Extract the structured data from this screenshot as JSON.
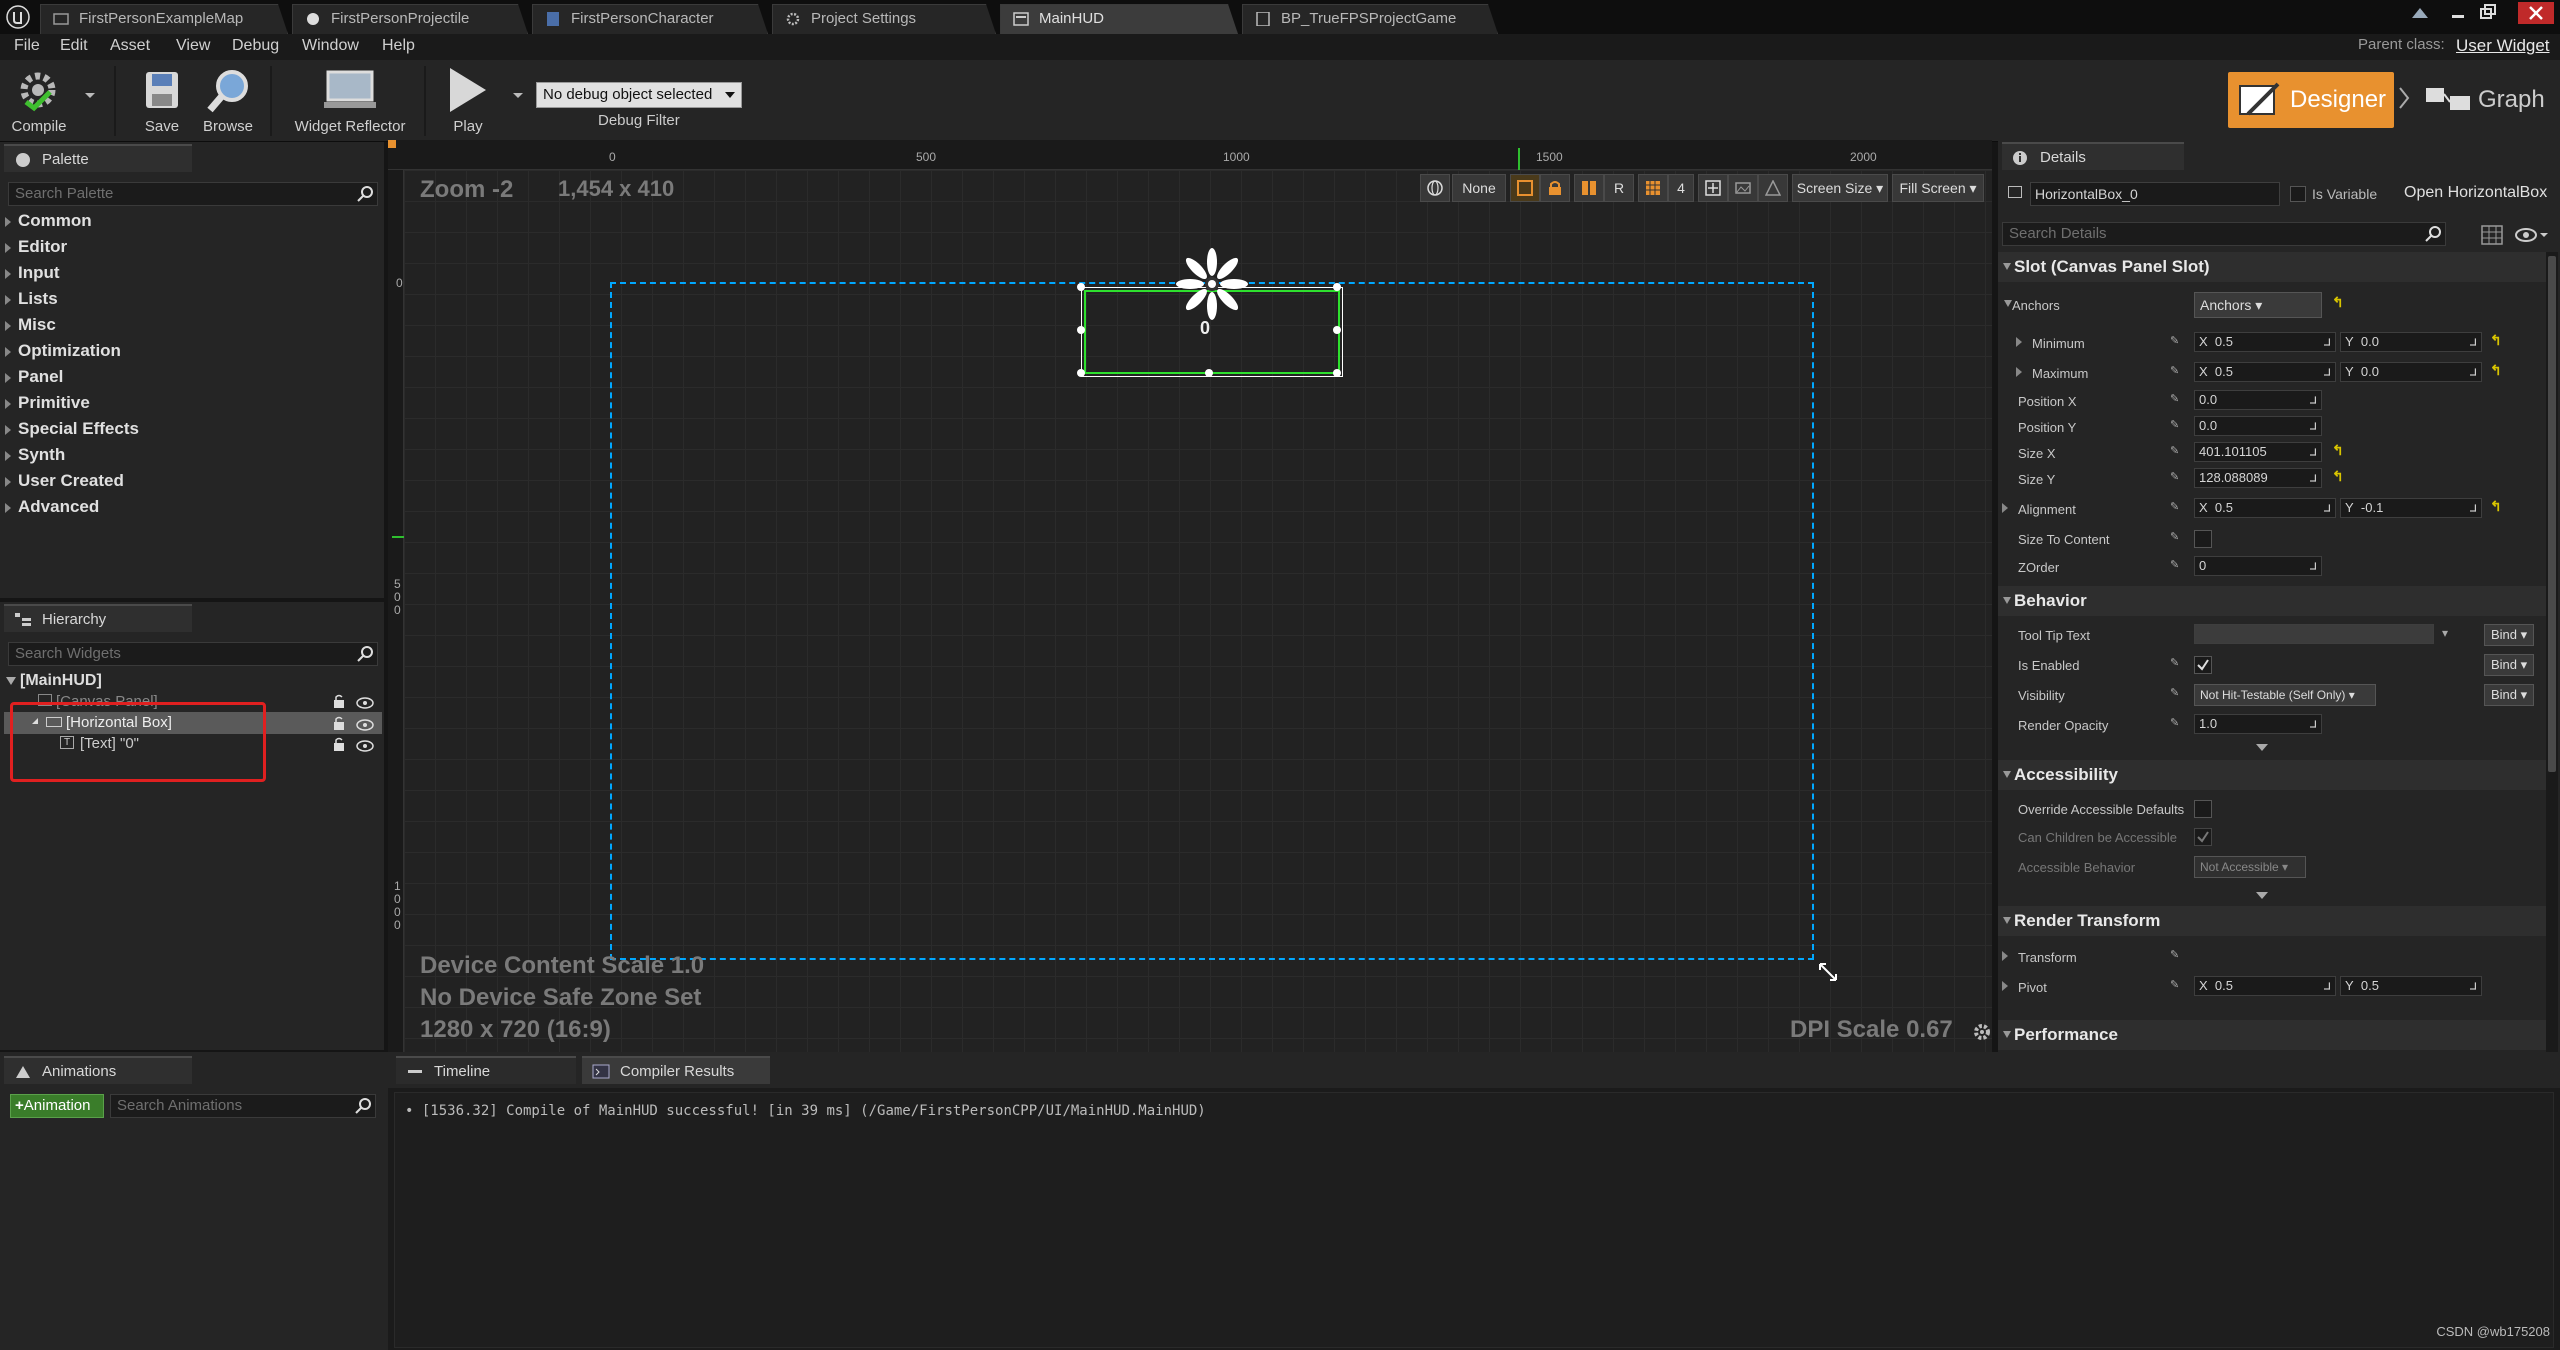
{
  "tabs": [
    {
      "label": "FirstPersonExampleMap",
      "icon": "map-icon"
    },
    {
      "label": "FirstPersonProjectile",
      "icon": "blueprint-icon"
    },
    {
      "label": "FirstPersonCharacter",
      "icon": "blueprint-icon"
    },
    {
      "label": "Project Settings",
      "icon": "gear-icon"
    },
    {
      "label": "MainHUD",
      "icon": "widget-icon"
    },
    {
      "label": "BP_TrueFPSProjectGame",
      "icon": "blueprint-icon"
    }
  ],
  "parent_class": {
    "label": "Parent class:",
    "value": "User Widget"
  },
  "menu": [
    "File",
    "Edit",
    "Asset",
    "View",
    "Debug",
    "Window",
    "Help"
  ],
  "toolbar": {
    "compile": "Compile",
    "save": "Save",
    "browse": "Browse",
    "widget_reflector": "Widget Reflector",
    "play": "Play",
    "debug_select": "No debug object selected",
    "debug_filter": "Debug Filter"
  },
  "mode": {
    "designer": "Designer",
    "graph": "Graph"
  },
  "palette": {
    "title": "Palette",
    "search_placeholder": "Search Palette",
    "categories": [
      "Common",
      "Editor",
      "Input",
      "Lists",
      "Misc",
      "Optimization",
      "Panel",
      "Primitive",
      "Special Effects",
      "Synth",
      "User Created",
      "Advanced"
    ]
  },
  "hierarchy": {
    "title": "Hierarchy",
    "search_placeholder": "Search Widgets",
    "root": "[MainHUD]",
    "canvas": "[Canvas Panel]",
    "hbox": "[Horizontal Box]",
    "text": "[Text] \"0\""
  },
  "viewport": {
    "zoom": "Zoom -2",
    "resolution": "1,454 x 410",
    "ruler_x": [
      "0",
      "500",
      "1000",
      "1500",
      "2000"
    ],
    "ruler_y": [
      "0",
      "5\n0\n0",
      "1\n0\n0\n0"
    ],
    "none_label": "None",
    "r_label": "R",
    "grid_value": "4",
    "screen_size": "Screen Size",
    "fill_screen": "Fill Screen",
    "widget_text": "0",
    "device_content_scale": "Device Content Scale 1.0",
    "safe_zone": "No Device Safe Zone Set",
    "resolution_note": "1280 x 720 (16:9)",
    "dpi_scale": "DPI Scale 0.67"
  },
  "details": {
    "title": "Details",
    "name_value": "HorizontalBox_0",
    "is_variable": "Is Variable",
    "open_link": "Open HorizontalBox",
    "search_placeholder": "Search Details",
    "slot_section": "Slot (Canvas Panel Slot)",
    "anchors_label": "Anchors",
    "anchors_value": "Anchors",
    "minimum": {
      "label": "Minimum",
      "x": "0.5",
      "y": "0.0"
    },
    "maximum": {
      "label": "Maximum",
      "x": "0.5",
      "y": "0.0"
    },
    "position_x": {
      "label": "Position X",
      "value": "0.0"
    },
    "position_y": {
      "label": "Position Y",
      "value": "0.0"
    },
    "size_x": {
      "label": "Size X",
      "value": "401.101105"
    },
    "size_y": {
      "label": "Size Y",
      "value": "128.088089"
    },
    "alignment": {
      "label": "Alignment",
      "x": "0.5",
      "y": "-0.1"
    },
    "size_to_content": "Size To Content",
    "zorder": {
      "label": "ZOrder",
      "value": "0"
    },
    "behavior_section": "Behavior",
    "tooltip": "Tool Tip Text",
    "is_enabled": "Is Enabled",
    "visibility": {
      "label": "Visibility",
      "value": "Not Hit-Testable (Self Only)"
    },
    "render_opacity": {
      "label": "Render Opacity",
      "value": "1.0"
    },
    "bind": "Bind",
    "accessibility_section": "Accessibility",
    "override_accessible": "Override Accessible Defaults",
    "children_accessible": "Can Children be Accessible",
    "accessible_behavior": {
      "label": "Accessible Behavior",
      "value": "Not Accessible"
    },
    "render_transform_section": "Render Transform",
    "transform": "Transform",
    "pivot": {
      "label": "Pivot",
      "x": "0.5",
      "y": "0.5"
    },
    "performance_section": "Performance",
    "x_label": "X",
    "y_label": "Y"
  },
  "bottom": {
    "animations_title": "Animations",
    "add_animation": "Animation",
    "search_animations": "Search Animations",
    "timeline_tab": "Timeline",
    "compiler_tab": "Compiler Results",
    "log_line": "[1536.32] Compile of MainHUD successful! [in 39 ms] (/Game/FirstPersonCPP/UI/MainHUD.MainHUD)"
  },
  "watermark": "CSDN @wb175208",
  "colors": {
    "accent": "#e8912f",
    "selection": "#00a8ff",
    "widget_outline": "#2ee02e",
    "highlight_box": "#e02020"
  }
}
